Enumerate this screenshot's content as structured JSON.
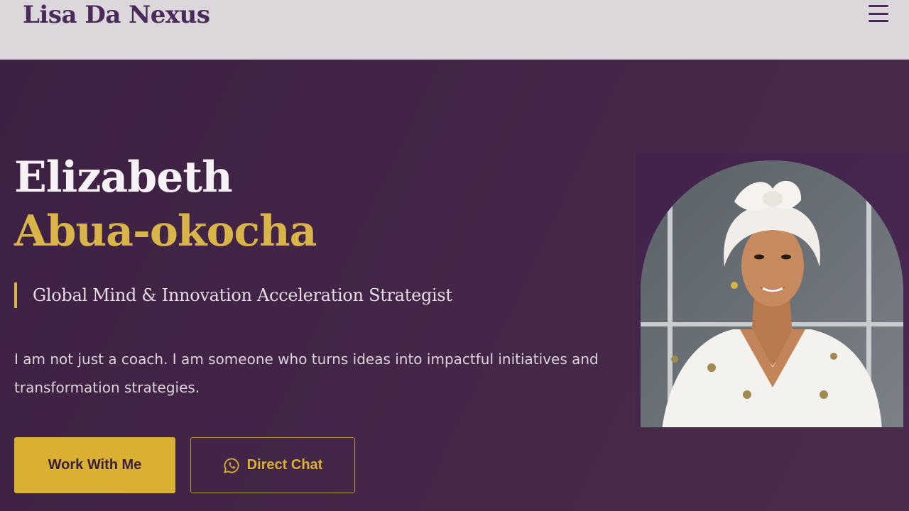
{
  "header": {
    "brand": "Lisa Da Nexus",
    "menu_icon": "hamburger-menu-icon"
  },
  "hero": {
    "first_name": "Elizabeth",
    "last_name": "Abua-okocha",
    "tagline": "Global Mind & Innovation Acceleration Strategist",
    "intro": "I am not just a coach. I am someone who turns ideas into impactful initiatives and transformation strategies.",
    "primary_button": "Work With Me",
    "secondary_button": "Direct Chat",
    "secondary_icon": "whatsapp-icon"
  },
  "colors": {
    "accent_gold": "#d9b031",
    "brand_purple": "#4a2a5a",
    "hero_background": "#432647"
  }
}
